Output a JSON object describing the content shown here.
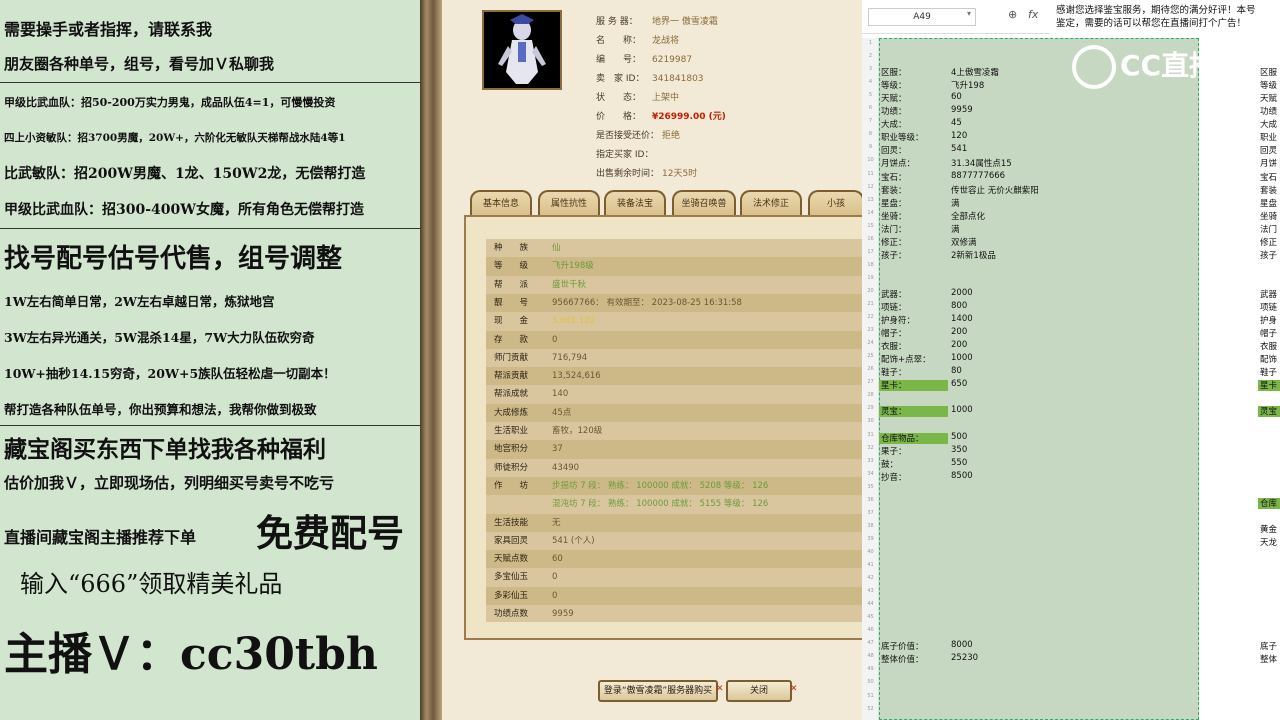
{
  "promo": {
    "lines": [
      "需要操手或者指挥，请联系我",
      "朋友圈各种单号，组号，看号加Ｖ私聊我",
      "甲级比武血队：招50-200万实力男鬼，成品队伍4=1，可慢慢投资",
      "四上小资敏队：招3700男魔，20W+，六阶化无敏队天梯帮战水陆4等1",
      "比武敏队：招200W男魔、1龙、150W2龙，无偿帮打造",
      "甲级比武血队：招300-400W女魔，所有角色无偿帮打造",
      "找号配号估号代售，组号调整",
      "1W左右简单日常，2W左右卓越日常，炼狱地宫",
      "3W左右异光通关，5W混杀14星，7W大力队伍砍穷奇",
      "10W+抽秒14.15穷奇，20W+5族队伍轻松虐一切副本！",
      "帮打造各种队伍单号，你出预算和想法，我帮你做到极致",
      "藏宝阁买东西下单找我各种福利",
      "估价加我Ｖ，立即现场估，列明细买号卖号不吃亏",
      "直播间藏宝阁主播推荐下单",
      "免费配号",
      "输入“666”领取精美礼品",
      "主播Ｖ：cc30tbh"
    ]
  },
  "game": {
    "info": [
      {
        "label": "服 务 器：",
        "value": "地界一 傲雪凌霜"
      },
      {
        "label": "名　　称：",
        "value": "龙战将"
      },
      {
        "label": "编　　号：",
        "value": "6219987"
      },
      {
        "label": "卖　家 ID：",
        "value": "341841803"
      },
      {
        "label": "状　　态：",
        "value": "上架中"
      },
      {
        "label": "价　　格：",
        "value": "¥26999.00 (元)"
      },
      {
        "label": "是否接受还价：",
        "value": "拒绝"
      },
      {
        "label": "指定买家 ID：",
        "value": ""
      },
      {
        "label": "出售剩余时间：",
        "value": "12天5时"
      }
    ],
    "tabs": [
      "基本信息",
      "属性抗性",
      "装备法宝",
      "坐骑召唤兽",
      "法术修正",
      "小孩"
    ],
    "attrs": [
      {
        "label": "种　　族",
        "value": "仙"
      },
      {
        "label": "等　　级",
        "value": "飞升198级"
      },
      {
        "label": "帮　　派",
        "value": "盛世千秋"
      },
      {
        "label": "靓　　号",
        "value": "95667766：  有效期至：  2023-08-25 16:31:58"
      },
      {
        "label": "现　　金",
        "value": "3,041,102"
      },
      {
        "label": "存　　款",
        "value": "0"
      },
      {
        "label": "师门贡献",
        "value": "716,794"
      },
      {
        "label": "帮派贡献",
        "value": "13,524,616"
      },
      {
        "label": "帮派成就",
        "value": "140"
      },
      {
        "label": "大成修炼",
        "value": "45点"
      },
      {
        "label": "生活职业",
        "value": "畜牧，120级"
      },
      {
        "label": "地宫积分",
        "value": "37"
      },
      {
        "label": "师徒积分",
        "value": "43490"
      },
      {
        "label": "作　　坊",
        "value": "步摇坊 7 段：  熟练： 100000  成就： 5208  等级： 126"
      },
      {
        "label": "",
        "value": "混沌坊 7 段：  熟练： 100000  成就： 5155  等级： 126"
      },
      {
        "label": "生活技能",
        "value": "无"
      },
      {
        "label": "家具回灵",
        "value": "541 (个人)"
      },
      {
        "label": "天赋点数",
        "value": "60"
      },
      {
        "label": "多宝仙玉",
        "value": "0"
      },
      {
        "label": "多彩仙玉",
        "value": "0"
      },
      {
        "label": "功绩点数",
        "value": "9959"
      }
    ],
    "buttons": {
      "login": "登录“傲雪凌霜”服务器购买",
      "close": "关闭"
    }
  },
  "sheet": {
    "name_box": "A49",
    "notice_1": "感谢您选择鉴宝服务，期待您的满分好评！本号",
    "notice_2": "鉴定，需要的话可以帮您在直播间打个广告！",
    "logo": "CC直播",
    "rows_top": [
      {
        "k": "区服：",
        "v": "4上傲雪凌霜"
      },
      {
        "k": "等级：",
        "v": "飞升198"
      },
      {
        "k": "天赋：",
        "v": "60"
      },
      {
        "k": "功绩：",
        "v": "9959"
      },
      {
        "k": "大成：",
        "v": "45"
      },
      {
        "k": "职业等级：",
        "v": "120"
      },
      {
        "k": "回灵：",
        "v": "541"
      },
      {
        "k": "月饼点：",
        "v": "31.34属性点15"
      },
      {
        "k": "宝石：",
        "v": "8877777666"
      },
      {
        "k": "套装：",
        "v": "传世容止 无价火麒紫阳"
      },
      {
        "k": "星盘：",
        "v": "满"
      },
      {
        "k": "坐骑：",
        "v": "全部点化"
      },
      {
        "k": "法门：",
        "v": "满"
      },
      {
        "k": "修正：",
        "v": "双修满"
      },
      {
        "k": "孩子：",
        "v": "2新新1极品"
      }
    ],
    "rows_mid": [
      {
        "k": "武器：",
        "v": "2000"
      },
      {
        "k": "项链：",
        "v": "800"
      },
      {
        "k": "护身符：",
        "v": "1400"
      },
      {
        "k": "帽子：",
        "v": "200"
      },
      {
        "k": "衣服：",
        "v": "200"
      },
      {
        "k": "配饰+点翠：",
        "v": "1000"
      },
      {
        "k": "鞋子：",
        "v": "80"
      },
      {
        "k": "星卡：",
        "v": "650"
      }
    ],
    "row_lingbao": {
      "k": "灵宝：",
      "v": "1000"
    },
    "rows_low": [
      {
        "k": "仓库物品：",
        "v": "500"
      },
      {
        "k": "果子：",
        "v": "350"
      },
      {
        "k": "鼓：",
        "v": "550"
      },
      {
        "k": "抄音：",
        "v": "8500"
      }
    ],
    "rows_bottom": [
      {
        "k": "底子价值：",
        "v": "8000"
      },
      {
        "k": "整体价值：",
        "v": "25230"
      }
    ],
    "right_edge_labels": [
      "区服",
      "等级",
      "天赋",
      "功绩",
      "大成",
      "职业",
      "回灵",
      "月饼",
      "宝石",
      "套装",
      "星盘",
      "坐骑",
      "法门",
      "修正",
      "孩子",
      "武器",
      "项链",
      "护身",
      "帽子",
      "衣服",
      "配饰",
      "鞋子",
      "星卡",
      "灵宝",
      "仓库",
      "黄金",
      "天龙",
      "底子",
      "整体"
    ],
    "colors": {
      "highlight": "#7ab648",
      "selection": "#c7d8c2",
      "dash": "#27b06a"
    }
  }
}
